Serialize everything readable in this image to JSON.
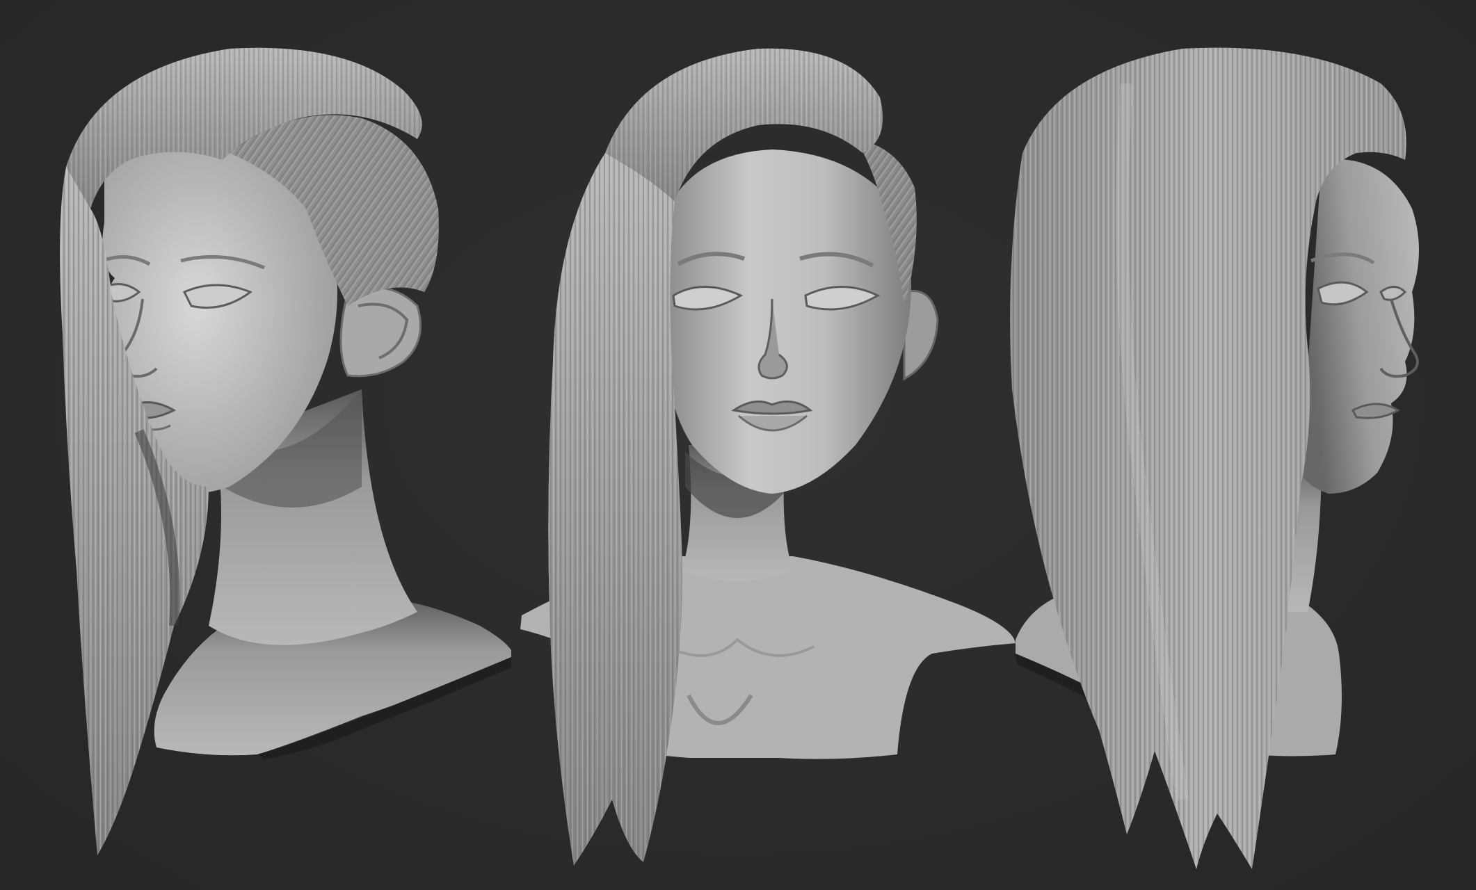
{
  "scene": {
    "background_color": "#2b2b2c",
    "material_color": "#9a9a9a",
    "views": [
      {
        "id": "three-quarter-left",
        "hair_style": "long straight side-swept, shaved side"
      },
      {
        "id": "front",
        "hair_style": "long straight side-swept, shaved side"
      },
      {
        "id": "three-quarter-right-back",
        "hair_style": "long straight side-swept"
      }
    ]
  }
}
